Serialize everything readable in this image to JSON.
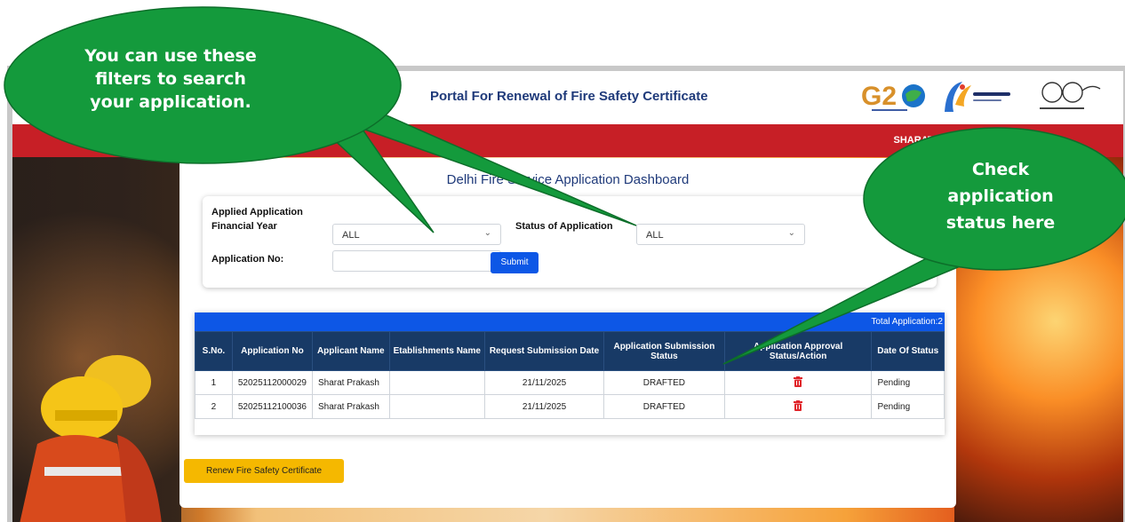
{
  "header": {
    "portal_title": "Portal For Renewal of Fire Safety Certificate",
    "user_name": "SHARAT PI"
  },
  "dashboard": {
    "title": "Delhi Fire Service Application Dashboard"
  },
  "filters": {
    "section_title": "Applied Application",
    "financial_year_label": "Financial Year",
    "financial_year_value": "ALL",
    "status_label": "Status of Application",
    "status_value": "ALL",
    "application_no_label": "Application No:",
    "application_no_value": "",
    "submit_label": "Submit"
  },
  "table": {
    "total_label": "Total Application:2",
    "headers": [
      "S.No.",
      "Application No",
      "Applicant Name",
      "Etablishments Name",
      "Request Submission Date",
      "Application Submission Status",
      "Application Approval Status/Action",
      "Date Of Status"
    ],
    "rows": [
      {
        "sno": "1",
        "app_no": "52025112000029",
        "applicant": "Sharat Prakash",
        "establishment": "",
        "date": "21/11/2025",
        "status": "DRAFTED",
        "approval_icon": "trash-icon",
        "date_status": "Pending"
      },
      {
        "sno": "2",
        "app_no": "52025112100036",
        "applicant": "Sharat Prakash",
        "establishment": "",
        "date": "21/11/2025",
        "status": "DRAFTED",
        "approval_icon": "trash-icon",
        "date_status": "Pending"
      }
    ]
  },
  "renew_button_label": "Renew Fire Safety Certificate",
  "callouts": {
    "filters_line1": "You can use these",
    "filters_line2": "filters to search",
    "filters_line3": "your application.",
    "status_line1": "Check",
    "status_line2": "application",
    "status_line3": "status here"
  },
  "colors": {
    "primary_blue": "#0d57e6",
    "header_red": "#c71f26",
    "table_header": "#183a66",
    "callout_green": "#149a3c",
    "renew_yellow": "#f5b800"
  }
}
